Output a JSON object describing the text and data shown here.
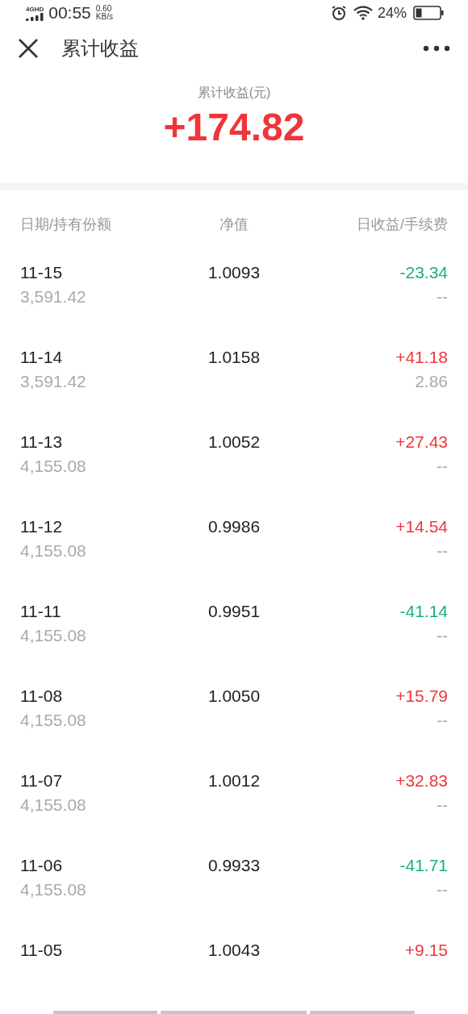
{
  "status_bar": {
    "network": "4GHD",
    "time": "00:55",
    "speed_value": "0.60",
    "speed_unit": "KB/s",
    "battery": "24%"
  },
  "header": {
    "title": "累计收益"
  },
  "summary": {
    "label": "累计收益(元)",
    "value": "+174.82",
    "color": "#f0353a"
  },
  "table": {
    "columns": [
      "日期/持有份额",
      "净值",
      "日收益/手续费"
    ],
    "rows": [
      {
        "date": "11-15",
        "shares": "3,591.42",
        "nav": "1.0093",
        "profit": "-23.34",
        "color": "#1aae7e",
        "fee": "--"
      },
      {
        "date": "11-14",
        "shares": "3,591.42",
        "nav": "1.0158",
        "profit": "+41.18",
        "color": "#f0353a",
        "fee": "2.86"
      },
      {
        "date": "11-13",
        "shares": "4,155.08",
        "nav": "1.0052",
        "profit": "+27.43",
        "color": "#f0353a",
        "fee": "--"
      },
      {
        "date": "11-12",
        "shares": "4,155.08",
        "nav": "0.9986",
        "profit": "+14.54",
        "color": "#f0353a",
        "fee": "--"
      },
      {
        "date": "11-11",
        "shares": "4,155.08",
        "nav": "0.9951",
        "profit": "-41.14",
        "color": "#1aae7e",
        "fee": "--"
      },
      {
        "date": "11-08",
        "shares": "4,155.08",
        "nav": "1.0050",
        "profit": "+15.79",
        "color": "#f0353a",
        "fee": "--"
      },
      {
        "date": "11-07",
        "shares": "4,155.08",
        "nav": "1.0012",
        "profit": "+32.83",
        "color": "#f0353a",
        "fee": "--"
      },
      {
        "date": "11-06",
        "shares": "4,155.08",
        "nav": "0.9933",
        "profit": "-41.71",
        "color": "#1aae7e",
        "fee": "--"
      },
      {
        "date": "11-05",
        "nav": "1.0043",
        "profit": "+9.15",
        "color": "#f0353a"
      }
    ]
  }
}
